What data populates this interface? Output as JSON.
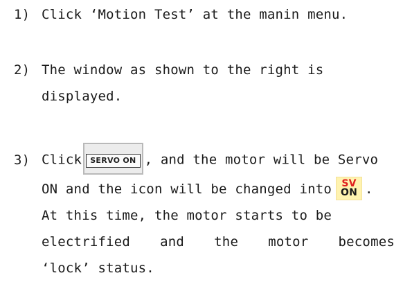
{
  "steps": [
    {
      "number": "1)",
      "text": "Click ‘Motion Test’ at the manin menu."
    },
    {
      "number": "2)",
      "line1": "The window as shown to the right is",
      "line2": "displayed."
    },
    {
      "number": "3)",
      "line1_prefix": "Click",
      "button_label": "SERVO ON",
      "line1_suffix": ", and the motor will be Servo",
      "line2_prefix": "ON and the icon will be changed into",
      "icon_top": "SV",
      "icon_bottom": "ON",
      "line2_suffix": ".",
      "line3": "At this time, the motor starts to be",
      "line4_words": [
        "electrified",
        "and",
        "the",
        "motor",
        "becomes"
      ],
      "line5": "‘lock’ status."
    }
  ],
  "colors": {
    "icon_background": "#fff3b0",
    "icon_sv_text": "#e02020",
    "button_face": "#fbfbfb"
  }
}
